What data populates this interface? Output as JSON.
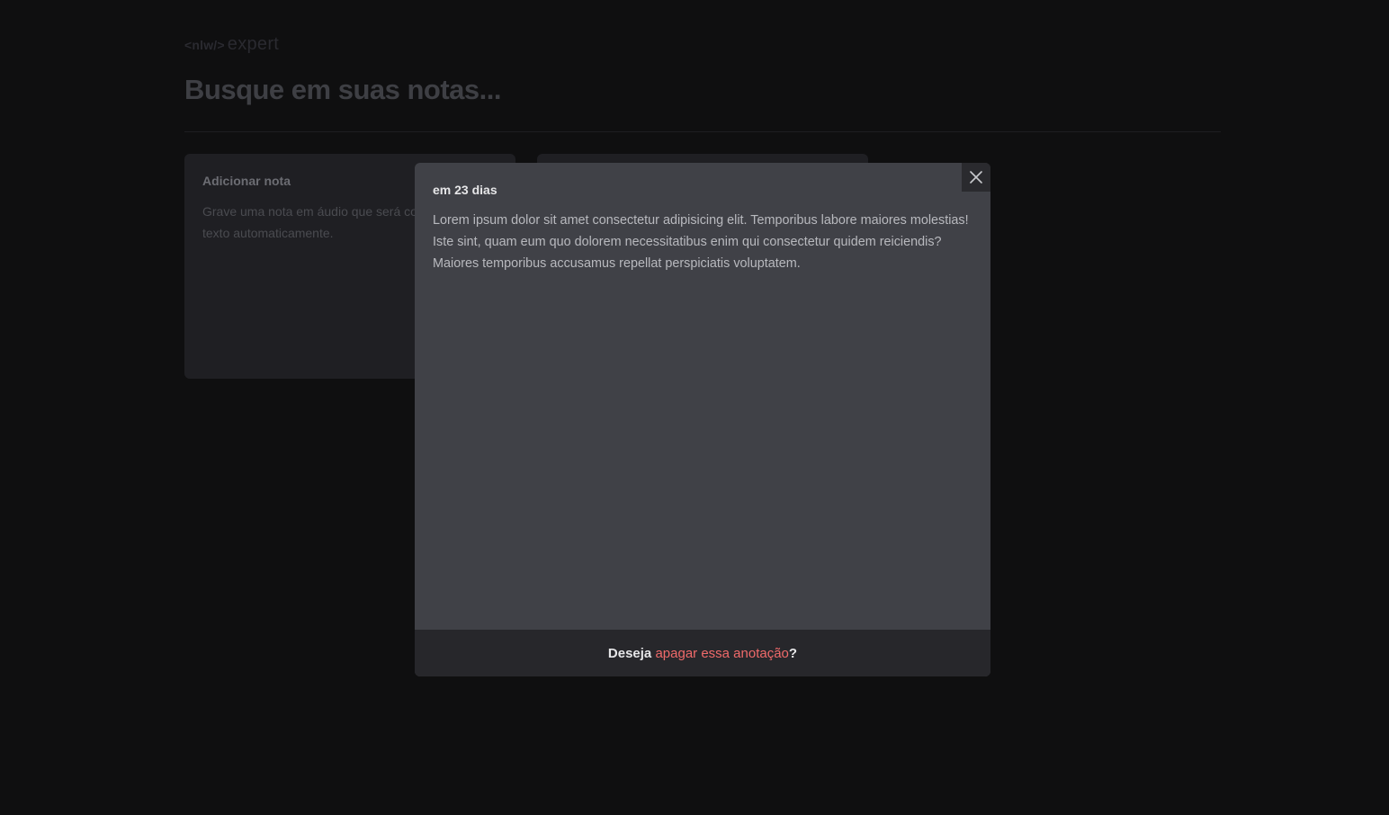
{
  "header": {
    "logo_tag": "<nlw/>",
    "logo_word": "expert"
  },
  "search": {
    "placeholder": "Busque em suas notas..."
  },
  "add_card": {
    "title": "Adicionar nota",
    "text": "Grave uma nota em áudio que será convertida para texto automaticamente."
  },
  "modal": {
    "date": "em 23 dias",
    "content": "Lorem ipsum dolor sit amet consectetur adipisicing elit. Temporibus labore maiores molestias! Iste sint, quam eum quo dolorem necessitatibus enim qui consectetur quidem reiciendis? Maiores temporibus accusamus repellat perspiciatis voluptatem.",
    "footer_prefix": "Deseja ",
    "footer_link": "apagar essa anotação",
    "footer_suffix": "?",
    "close_icon": "close-icon"
  },
  "colors": {
    "background": "#0f0f10",
    "modal": "#404147",
    "footer": "#27272b",
    "danger": "#f06a6a"
  }
}
